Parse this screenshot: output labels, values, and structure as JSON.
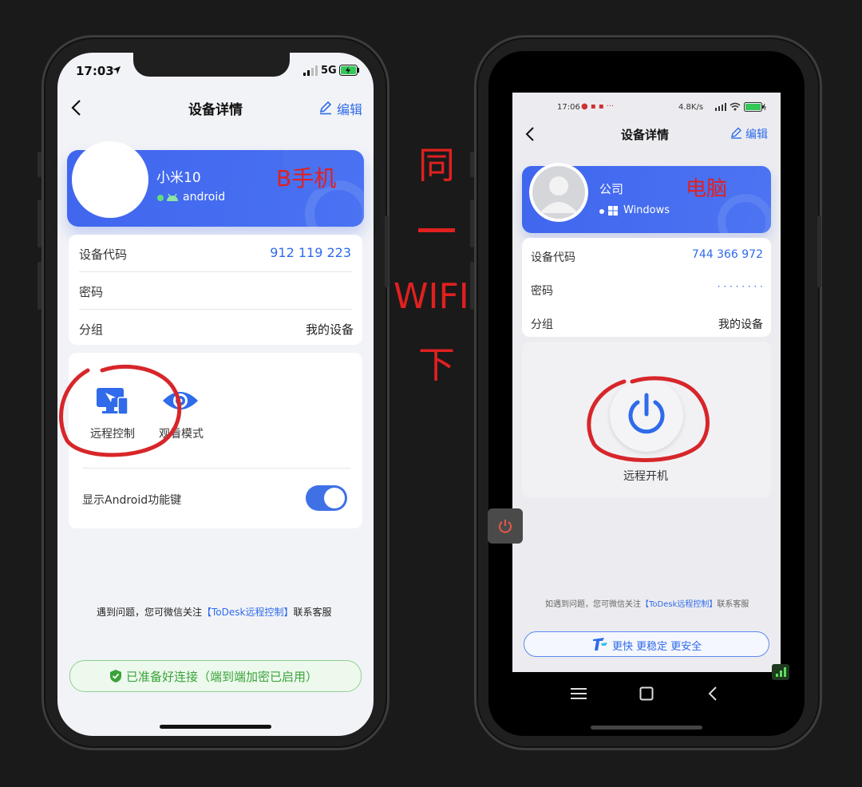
{
  "left_phone": {
    "status_time": "17:03",
    "status_network": "5G",
    "nav_title": "设备详情",
    "edit_label": "编辑",
    "device_name": "小米10",
    "device_os": "android",
    "annotation": "B手机",
    "device_code_label": "设备代码",
    "device_code_value": "912 119 223",
    "password_label": "密码",
    "group_label": "分组",
    "group_value": "我的设备",
    "remote_control_label": "远程控制",
    "watch_mode_label": "观看模式",
    "android_keys_label": "显示Android功能键",
    "android_keys_on": true,
    "help_prefix": "遇到问题，您可微信关注",
    "help_link": "【ToDesk远程控制】",
    "help_suffix": "联系客服",
    "connection_status": "已准备好连接（端到端加密已启用）"
  },
  "middle_annotation": {
    "chars": [
      "同",
      "一",
      "WIFI",
      "下"
    ]
  },
  "right_phone": {
    "status_time": "17:06",
    "status_speed": "4.8K/s",
    "nav_title": "设备详情",
    "edit_label": "编辑",
    "device_name": "公司",
    "device_os": "Windows",
    "annotation": "电脑",
    "device_code_label": "设备代码",
    "device_code_value": "744 366 972",
    "password_label": "密码",
    "password_value": "· · · · · · · ·",
    "group_label": "分组",
    "group_value": "我的设备",
    "power_label": "远程开机",
    "help_prefix": "如遇到问题，您可微信关注",
    "help_link": "【ToDesk远程控制】",
    "help_suffix": "联系客服",
    "promo_label": "更快 更稳定 更安全"
  },
  "colors": {
    "accent": "#2f6bea",
    "card_blue": "#4169ee",
    "annotation_red": "#e02020",
    "ok_green": "#3aa33a"
  }
}
